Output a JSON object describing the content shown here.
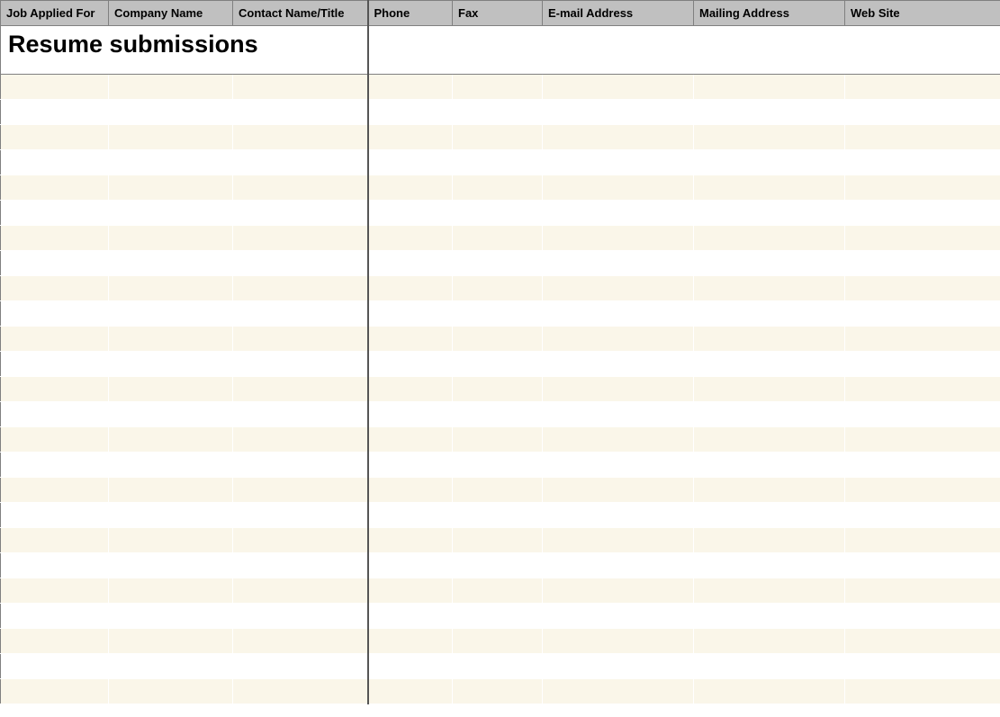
{
  "title": "Resume submissions",
  "columns": [
    "Job Applied For",
    "Company Name",
    "Contact Name/Title",
    "Phone",
    "Fax",
    "E-mail Address",
    "Mailing Address",
    "Web Site"
  ],
  "rows": [
    [
      "",
      "",
      "",
      "",
      "",
      "",
      "",
      ""
    ],
    [
      "",
      "",
      "",
      "",
      "",
      "",
      "",
      ""
    ],
    [
      "",
      "",
      "",
      "",
      "",
      "",
      "",
      ""
    ],
    [
      "",
      "",
      "",
      "",
      "",
      "",
      "",
      ""
    ],
    [
      "",
      "",
      "",
      "",
      "",
      "",
      "",
      ""
    ],
    [
      "",
      "",
      "",
      "",
      "",
      "",
      "",
      ""
    ],
    [
      "",
      "",
      "",
      "",
      "",
      "",
      "",
      ""
    ],
    [
      "",
      "",
      "",
      "",
      "",
      "",
      "",
      ""
    ],
    [
      "",
      "",
      "",
      "",
      "",
      "",
      "",
      ""
    ],
    [
      "",
      "",
      "",
      "",
      "",
      "",
      "",
      ""
    ],
    [
      "",
      "",
      "",
      "",
      "",
      "",
      "",
      ""
    ],
    [
      "",
      "",
      "",
      "",
      "",
      "",
      "",
      ""
    ],
    [
      "",
      "",
      "",
      "",
      "",
      "",
      "",
      ""
    ],
    [
      "",
      "",
      "",
      "",
      "",
      "",
      "",
      ""
    ],
    [
      "",
      "",
      "",
      "",
      "",
      "",
      "",
      ""
    ],
    [
      "",
      "",
      "",
      "",
      "",
      "",
      "",
      ""
    ],
    [
      "",
      "",
      "",
      "",
      "",
      "",
      "",
      ""
    ],
    [
      "",
      "",
      "",
      "",
      "",
      "",
      "",
      ""
    ],
    [
      "",
      "",
      "",
      "",
      "",
      "",
      "",
      ""
    ],
    [
      "",
      "",
      "",
      "",
      "",
      "",
      "",
      ""
    ],
    [
      "",
      "",
      "",
      "",
      "",
      "",
      "",
      ""
    ],
    [
      "",
      "",
      "",
      "",
      "",
      "",
      "",
      ""
    ],
    [
      "",
      "",
      "",
      "",
      "",
      "",
      "",
      ""
    ],
    [
      "",
      "",
      "",
      "",
      "",
      "",
      "",
      ""
    ],
    [
      "",
      "",
      "",
      "",
      "",
      "",
      "",
      ""
    ]
  ]
}
